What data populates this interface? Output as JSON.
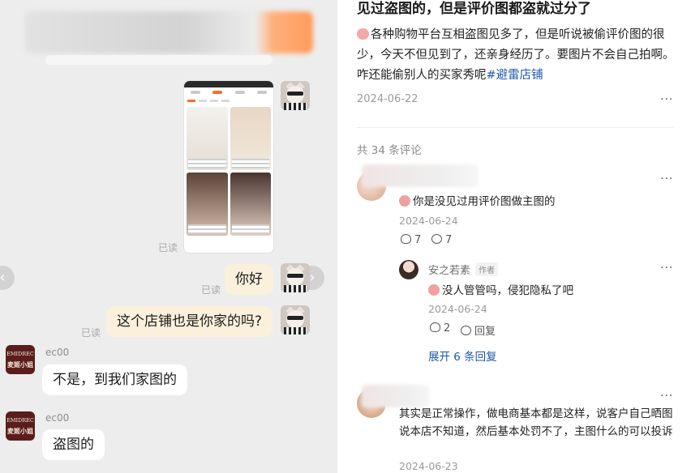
{
  "chat": {
    "status_read": "已读",
    "messages": {
      "m1": "你好",
      "m2": "这个店铺也是你家的吗?",
      "r1": "不是，到我们家图的",
      "r2": "盗图的"
    },
    "shop_sender": "ec00",
    "shop_avatar": {
      "line1": "EMIDREC",
      "line2": "麦姬小姐"
    },
    "nav_prev_icon": "chevron-left-icon",
    "nav_next_icon": "chevron-right-icon"
  },
  "post": {
    "title": "见过盗图的，但是评价图都盗就过分了",
    "body_text": "各种购物平台互相盗图见多了，但是听说被偷评价图的很少，今天不但见到了，还亲身经历了。要图片不会自己拍啊。咋还能偷别人的买家秀呢",
    "hashtag": "#避雷店铺",
    "date": "2024-06-22",
    "more": "···",
    "comment_count": "共 34 条评论"
  },
  "comments": [
    {
      "text": "你是没见过用评价图做主图的",
      "date": "2024-06-24",
      "likes": "7",
      "replies": "7",
      "reply": {
        "author": "安之若素",
        "badge": "作者",
        "text": "没人管管吗，侵犯隐私了吧",
        "date": "2024-06-24",
        "likes": "2",
        "reply_label": "回复"
      },
      "expand_label": "展开 6 条回复"
    },
    {
      "text": "其实是正常操作，做电商基本都是这样，说客户自己晒图说本店不知道，然后基本处罚不了，主图什么的可以投诉",
      "date": "2024-06-23"
    }
  ]
}
